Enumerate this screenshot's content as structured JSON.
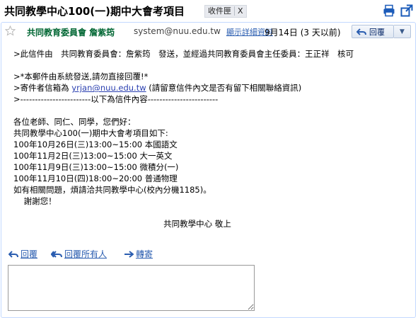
{
  "subject": "共同教學中心100(一)期中大會考項目",
  "label": {
    "name": "收件匣",
    "remove": "X"
  },
  "icons": {
    "print": "print-icon",
    "new_window": "new-window-icon",
    "star": "star-icon",
    "reply": "reply-arrow-icon",
    "reply_all": "reply-all-icon",
    "forward": "forward-arrow-icon"
  },
  "message": {
    "sender_name": "共同教育委員會 詹紫筠",
    "sender_email": "system@nuu.edu.tw",
    "details_link": "顯示詳細資料",
    "date": "9月14日 (3 天以前)",
    "reply_button": "回覆",
    "more_button": "▼",
    "body_lines": [
      ">此信件由　共同教育委員會：詹紫筠　發送，並經過共同教育委員會主任委員：王正祥　核可",
      "",
      ">*本郵件由系統發送,請勿直接回覆!*",
      "",
      ">------------------------以下為信件內容------------------------",
      "",
      "各位老師、同仁、同學，您們好：",
      "共同教學中心100(一)期中大會考項目如下:",
      "100年10月26日(三)13:00~15:00 本國語文",
      "100年11月2日(三)13:00~15:00 大一英文",
      "100年11月9日(三)13:00~15:00 微積分(一)",
      "100年11月10日(四)18:00~20:00 普通物理",
      "如有相關問題，煩請洽共同教學中心(校內分機1185)。",
      "    謝謝您！",
      "",
      "",
      "共同教學中心 敬上"
    ],
    "mailbox_prefix": ">寄件者信箱為 ",
    "mailbox_link": "yrjan@nuu.edu.tw",
    "mailbox_suffix": " (請留意信件內文是否有留下相關聯絡資訊)"
  },
  "actions": {
    "reply": "回覆",
    "reply_all": "回覆所有人",
    "forward": "轉寄"
  },
  "colors": {
    "sender": "#006633",
    "link": "#2a5db0",
    "card_border": "#c3d9ff"
  }
}
